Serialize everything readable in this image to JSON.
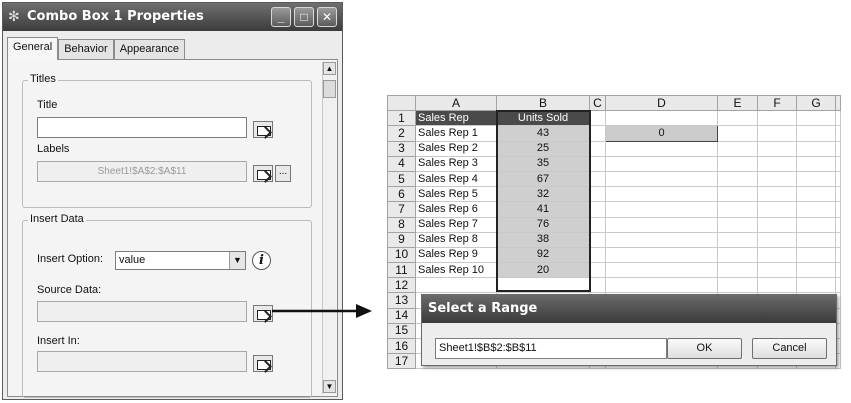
{
  "dialog": {
    "title": "Combo Box 1 Properties",
    "app_icon": "gear-icon",
    "window_buttons": {
      "minimize": "_",
      "maximize": "□",
      "close": "✕"
    },
    "tabs": [
      {
        "label": "General",
        "active": true
      },
      {
        "label": "Behavior",
        "active": false
      },
      {
        "label": "Appearance",
        "active": false
      }
    ],
    "titles_group": {
      "legend": "Titles",
      "title_label": "Title",
      "title_value": "",
      "labels_label": "Labels",
      "labels_value": "Sheet1!$A$2:$A$11",
      "more_button": "..."
    },
    "insert_group": {
      "legend": "Insert Data",
      "insert_option_label": "Insert Option:",
      "insert_option_value": "value",
      "source_data_label": "Source Data:",
      "source_data_value": "",
      "insert_in_label": "Insert In:",
      "insert_in_value": ""
    }
  },
  "sheet": {
    "columns": [
      "A",
      "B",
      "C",
      "D",
      "E",
      "F",
      "G"
    ],
    "rows": [
      "1",
      "2",
      "3",
      "4",
      "5",
      "6",
      "7",
      "8",
      "9",
      "10",
      "11",
      "12",
      "13",
      "14",
      "15",
      "16",
      "17"
    ],
    "header": {
      "a1": "Sales Rep",
      "b1": "Units Sold"
    },
    "data": [
      {
        "rep": "Sales Rep 1",
        "units": "43"
      },
      {
        "rep": "Sales Rep 2",
        "units": "25"
      },
      {
        "rep": "Sales Rep 3",
        "units": "35"
      },
      {
        "rep": "Sales Rep 4",
        "units": "67"
      },
      {
        "rep": "Sales Rep 5",
        "units": "32"
      },
      {
        "rep": "Sales Rep 6",
        "units": "41"
      },
      {
        "rep": "Sales Rep 7",
        "units": "76"
      },
      {
        "rep": "Sales Rep 8",
        "units": "38"
      },
      {
        "rep": "Sales Rep 9",
        "units": "92"
      },
      {
        "rep": "Sales Rep 10",
        "units": "20"
      }
    ],
    "d2_value": "0"
  },
  "range_dialog": {
    "title": "Select a Range",
    "range_value": "Sheet1!$B$2:$B$11",
    "ok_label": "OK",
    "cancel_label": "Cancel"
  }
}
